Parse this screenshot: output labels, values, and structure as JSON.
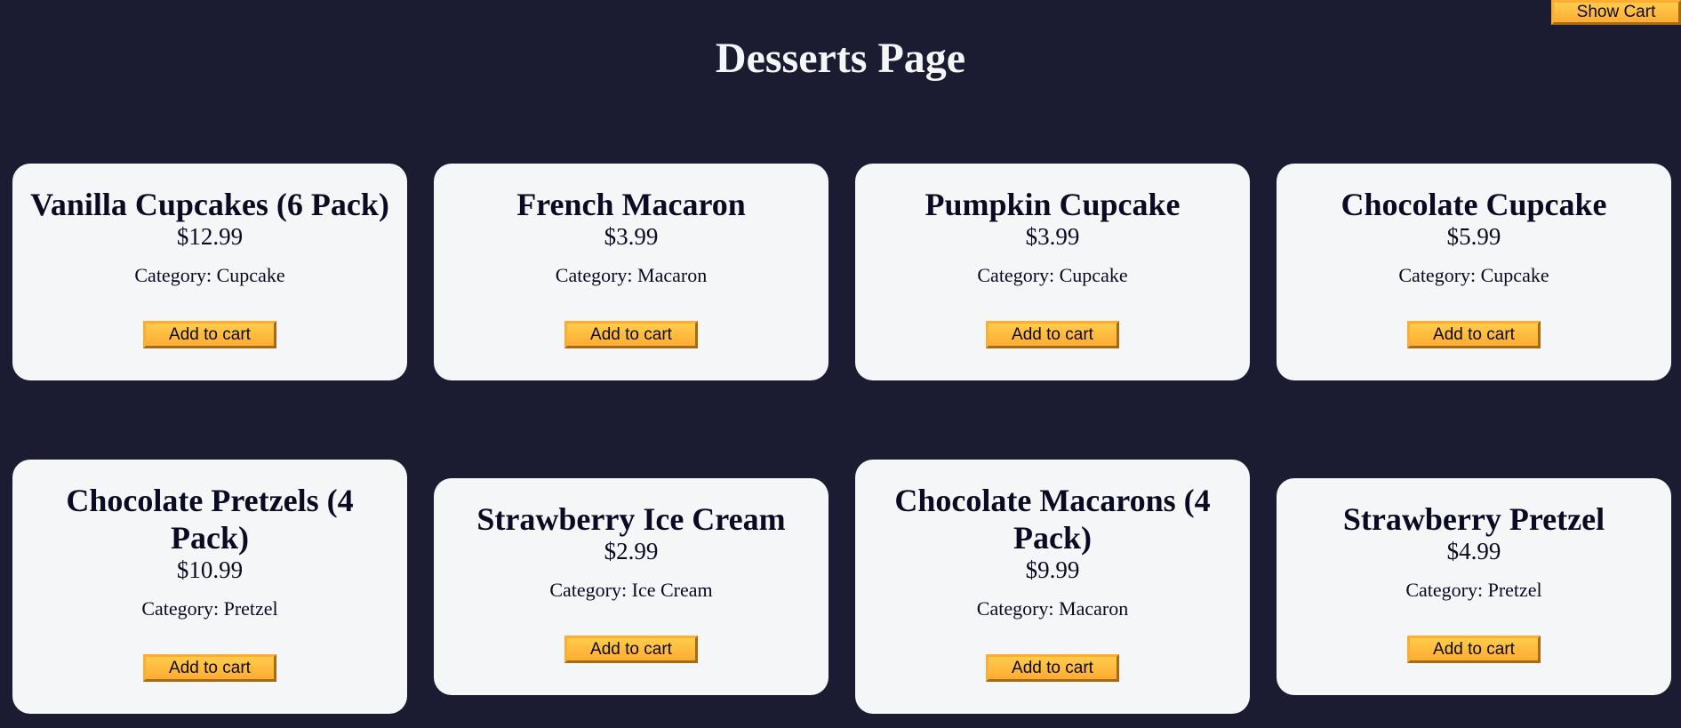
{
  "header": {
    "title": "Desserts Page",
    "show_cart_label": "Show Cart"
  },
  "products": [
    {
      "name": "Vanilla Cupcakes (6 Pack)",
      "price": "$12.99",
      "category": "Category: Cupcake",
      "button": "Add to cart"
    },
    {
      "name": "French Macaron",
      "price": "$3.99",
      "category": "Category: Macaron",
      "button": "Add to cart"
    },
    {
      "name": "Pumpkin Cupcake",
      "price": "$3.99",
      "category": "Category: Cupcake",
      "button": "Add to cart"
    },
    {
      "name": "Chocolate Cupcake",
      "price": "$5.99",
      "category": "Category: Cupcake",
      "button": "Add to cart"
    },
    {
      "name": "Chocolate Pretzels (4 Pack)",
      "price": "$10.99",
      "category": "Category: Pretzel",
      "button": "Add to cart"
    },
    {
      "name": "Strawberry Ice Cream",
      "price": "$2.99",
      "category": "Category: Ice Cream",
      "button": "Add to cart"
    },
    {
      "name": "Chocolate Macarons (4 Pack)",
      "price": "$9.99",
      "category": "Category: Macaron",
      "button": "Add to cart"
    },
    {
      "name": "Strawberry Pretzel",
      "price": "$4.99",
      "category": "Category: Pretzel",
      "button": "Add to cart"
    }
  ],
  "colors": {
    "background": "#1b1b32",
    "card": "#f5f6f7",
    "button": "#feac32",
    "text": "#0a0a23"
  }
}
